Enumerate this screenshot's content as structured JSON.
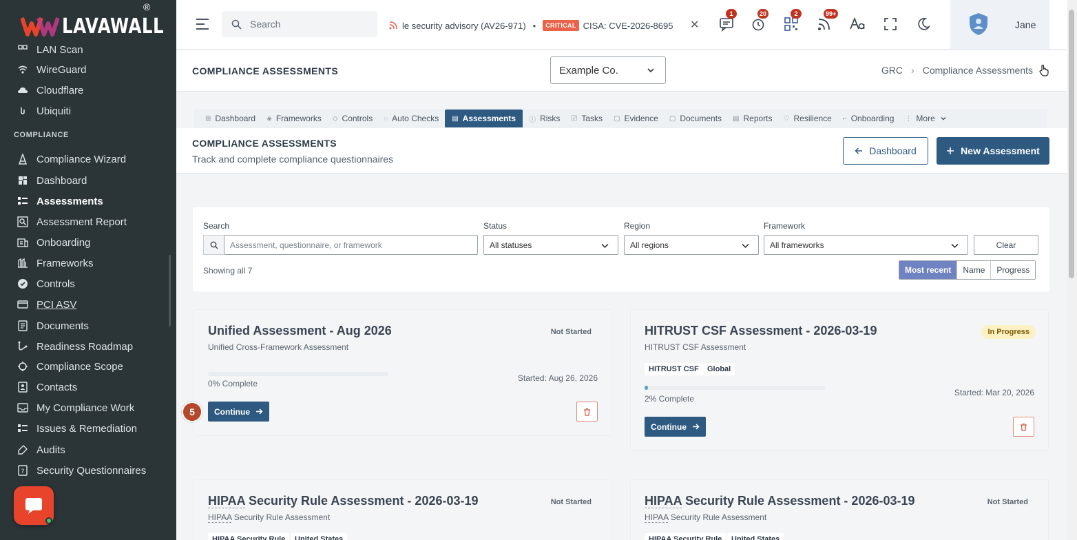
{
  "app": {
    "logo_text": "LAVAWALL",
    "logo_reg": "®"
  },
  "sidebar": {
    "items_top": [
      {
        "label": "LAN Scan",
        "icon": "scan-icon"
      },
      {
        "label": "WireGuard",
        "icon": "wireguard-icon"
      },
      {
        "label": "Cloudflare",
        "icon": "cloud-icon"
      },
      {
        "label": "Ubiquiti",
        "icon": "ubiquiti-icon"
      }
    ],
    "section": "COMPLIANCE",
    "items": [
      {
        "label": "Compliance Wizard",
        "icon": "wizard-icon"
      },
      {
        "label": "Dashboard",
        "icon": "dashboard-icon"
      },
      {
        "label": "Assessments",
        "icon": "list-icon",
        "active": true
      },
      {
        "label": "Assessment Report",
        "icon": "report-search-icon"
      },
      {
        "label": "Onboarding",
        "icon": "onboarding-icon"
      },
      {
        "label": "Frameworks",
        "icon": "frameworks-icon"
      },
      {
        "label": "Controls",
        "icon": "controls-icon"
      },
      {
        "label": "PCI ASV",
        "icon": "pci-icon"
      },
      {
        "label": "Documents",
        "icon": "documents-icon"
      },
      {
        "label": "Readiness Roadmap",
        "icon": "roadmap-icon"
      },
      {
        "label": "Compliance Scope",
        "icon": "scope-icon"
      },
      {
        "label": "Contacts",
        "icon": "contacts-icon"
      },
      {
        "label": "My Compliance Work",
        "icon": "inbox-icon"
      },
      {
        "label": "Issues & Remediation",
        "icon": "issues-icon"
      },
      {
        "label": "Audits",
        "icon": "audits-icon"
      },
      {
        "label": "Security Questionnaires",
        "icon": "questionnaire-icon"
      }
    ]
  },
  "topbar": {
    "search_placeholder": "Search",
    "ticker_text_1": "le security advisory (AV26-971)",
    "ticker_badge": "CRITICAL",
    "ticker_text_2": "CISA: CVE-2026-8695",
    "icons": [
      {
        "name": "messages-icon",
        "badge": "1"
      },
      {
        "name": "alarm-icon",
        "badge": "20"
      },
      {
        "name": "qr-icon",
        "badge": "2"
      },
      {
        "name": "feed-icon",
        "badge": "99+"
      },
      {
        "name": "font-size-icon",
        "badge": ""
      },
      {
        "name": "fullscreen-icon",
        "badge": ""
      },
      {
        "name": "dark-mode-icon",
        "badge": ""
      }
    ],
    "user_name": "Jane"
  },
  "page_header": {
    "title": "COMPLIANCE ASSESSMENTS",
    "org": "Example Co.",
    "breadcrumb": [
      "GRC",
      "Compliance Assessments"
    ]
  },
  "tabs": [
    {
      "label": "Dashboard",
      "icon": "⊞"
    },
    {
      "label": "Frameworks",
      "icon": "◈"
    },
    {
      "label": "Controls",
      "icon": "◇"
    },
    {
      "label": "Auto Checks",
      "icon": "◌"
    },
    {
      "label": "Assessments",
      "icon": "▤",
      "active": true
    },
    {
      "label": "Risks",
      "icon": "ⓘ"
    },
    {
      "label": "Tasks",
      "icon": "☑"
    },
    {
      "label": "Evidence",
      "icon": "▢"
    },
    {
      "label": "Documents",
      "icon": "▢"
    },
    {
      "label": "Reports",
      "icon": "▤"
    },
    {
      "label": "Resilience",
      "icon": "♡"
    },
    {
      "label": "Onboarding",
      "icon": "⌐"
    },
    {
      "label": "More",
      "icon": "⋮"
    }
  ],
  "section": {
    "title": "COMPLIANCE ASSESSMENTS",
    "subtitle": "Track and complete compliance questionnaires",
    "back_label": "Dashboard",
    "new_label": "New Assessment"
  },
  "filters": {
    "search_label": "Search",
    "search_placeholder": "Assessment, questionnaire, or framework",
    "status_label": "Status",
    "status_value": "All statuses",
    "region_label": "Region",
    "region_value": "All regions",
    "framework_label": "Framework",
    "framework_value": "All frameworks",
    "clear_label": "Clear",
    "showing": "Showing all 7",
    "sort_options": [
      "Most recent",
      "Name",
      "Progress"
    ]
  },
  "cards": [
    {
      "title": "Unified Assessment - Aug 2026",
      "subtitle": "Unified Cross-Framework Assessment",
      "status": "Not Started",
      "tags": [],
      "progress": 0,
      "complete_text": "0% Complete",
      "started": "Started: Aug 26, 2026",
      "continue_label": "Continue"
    },
    {
      "title": "HITRUST CSF Assessment - 2026-03-19",
      "subtitle": "HITRUST CSF Assessment",
      "status": "In Progress",
      "tags": [
        "HITRUST CSF",
        "Global"
      ],
      "progress": 2,
      "complete_text": "2% Complete",
      "started": "Started: Mar 20, 2026",
      "continue_label": "Continue"
    },
    {
      "title_abbr": "HIPAA",
      "title_rest": " Security Rule Assessment - 2026-03-19",
      "subtitle_abbr": "HIPAA",
      "subtitle_rest": " Security Rule Assessment",
      "status": "Not Started",
      "tags": [
        "HIPAA Security Rule",
        "United States"
      ]
    },
    {
      "title_abbr": "HIPAA",
      "title_rest": " Security Rule Assessment - 2026-03-19",
      "subtitle_abbr": "HIPAA",
      "subtitle_rest": " Security Rule Assessment",
      "status": "Not Started",
      "tags": [
        "HIPAA Security Rule",
        "United States"
      ]
    }
  ],
  "step_marker": "5",
  "colors": {
    "primary": "#2e5a82",
    "sidebar": "#2b3437",
    "brand": "#e8442b",
    "sort_active": "#6f82c2"
  }
}
